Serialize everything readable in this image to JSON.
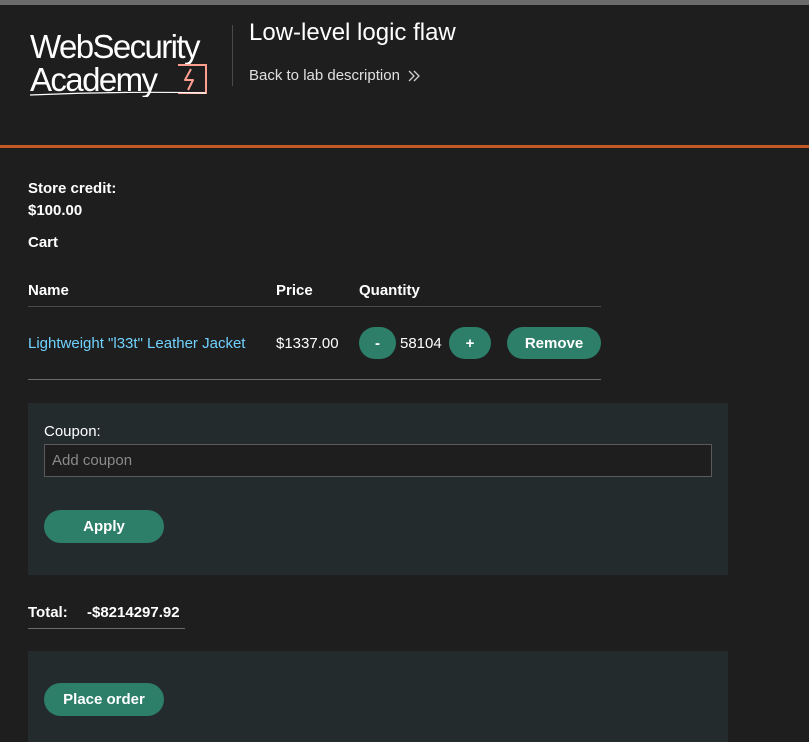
{
  "header": {
    "logo_line1": "WebSecurity",
    "logo_line2": "Academy",
    "lab_title": "Low-level logic flaw",
    "back_link": "Back to lab description"
  },
  "account": {
    "store_credit_label": "Store credit:",
    "store_credit_value": "$100.00"
  },
  "cart": {
    "heading": "Cart",
    "columns": [
      "Name",
      "Price",
      "Quantity"
    ],
    "items": [
      {
        "name": "Lightweight \"l33t\" Leather Jacket",
        "price": "$1337.00",
        "quantity": "58104",
        "decrement_label": "-",
        "increment_label": "+",
        "remove_label": "Remove"
      }
    ]
  },
  "coupon": {
    "label": "Coupon:",
    "placeholder": "Add coupon",
    "value": "",
    "apply_label": "Apply"
  },
  "total": {
    "label": "Total:",
    "value": "-$8214297.92"
  },
  "order": {
    "place_order_label": "Place order"
  },
  "colors": {
    "accent_orange": "#c25925",
    "button_green": "#2d7f6a",
    "link_blue": "#70d2ff",
    "logo_bolt_pink": "#ff9f8f"
  }
}
